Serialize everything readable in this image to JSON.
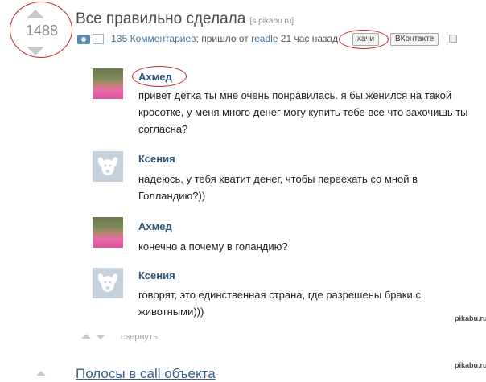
{
  "post": {
    "rating": "1488",
    "title": "Все правильно сделала",
    "source": "[s.pikabu.ru]",
    "minus_label": "–",
    "comments_link": "135 Комментариев",
    "posted_text": "; пришло от",
    "author": "readle",
    "time_ago": "21 час назад",
    "tag": "хачи",
    "share_label": "ВКонтакте"
  },
  "comments": [
    {
      "author": "Ахмед",
      "avatar": "photo",
      "text": "привет детка ты мне очень понравилась. я бы женился на такой кросотке, у меня много денег могу купить тебе все что захочишь ты согласна?"
    },
    {
      "author": "Ксения",
      "avatar": "vk-dog",
      "text": "надеюсь, у тебя хватит денег, чтобы переехать со мной в Голландию?))"
    },
    {
      "author": "Ахмед",
      "avatar": "photo",
      "text": "конечно а почему в голандию?"
    },
    {
      "author": "Ксения",
      "avatar": "vk-dog",
      "text": "говорят, это единственная страна, где разрешены браки с животными)))"
    }
  ],
  "comments_footer": {
    "collapse_label": "свернуть"
  },
  "watermarks": [
    "pikabu.ru",
    "pikabu.ru"
  ],
  "next_post": {
    "title": "Полосы в call объекта"
  },
  "colors": {
    "highlight": "#c0292b",
    "link": "#2b587a",
    "vote_arrow": "#c8c8c8"
  },
  "icons": [
    "vote-up-icon",
    "vote-down-icon",
    "camera-icon",
    "save-icon",
    "vk-dog-icon"
  ]
}
